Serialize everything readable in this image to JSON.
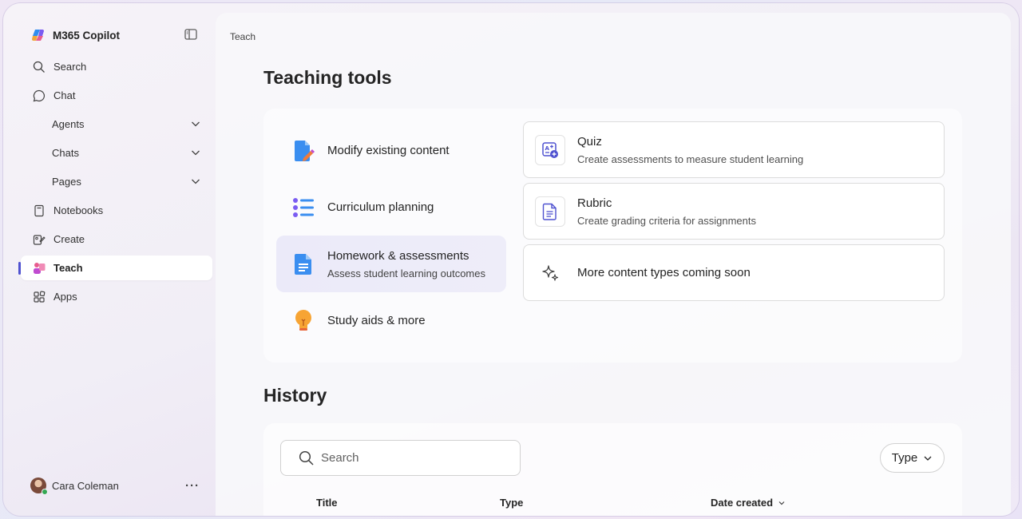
{
  "app": {
    "name": "M365 Copilot"
  },
  "sidebar": {
    "items": [
      {
        "label": "Search",
        "icon": "search-icon"
      },
      {
        "label": "Chat",
        "icon": "chat-icon"
      },
      {
        "label": "Agents",
        "expandable": true
      },
      {
        "label": "Chats",
        "expandable": true
      },
      {
        "label": "Pages",
        "expandable": true
      },
      {
        "label": "Notebooks",
        "icon": "notebook-icon"
      },
      {
        "label": "Create",
        "icon": "create-icon"
      },
      {
        "label": "Teach",
        "icon": "teach-icon",
        "active": true
      },
      {
        "label": "Apps",
        "icon": "apps-icon"
      }
    ],
    "user": {
      "name": "Cara Coleman",
      "more": "···"
    }
  },
  "main": {
    "breadcrumb": "Teach",
    "title": "Teaching tools",
    "categories": [
      {
        "title": "Modify existing content",
        "subtitle": "",
        "icon": "pencil-doc-icon"
      },
      {
        "title": "Curriculum planning",
        "subtitle": "",
        "icon": "list-icon"
      },
      {
        "title": "Homework & assessments",
        "subtitle": "Assess student learning outcomes",
        "icon": "document-icon",
        "selected": true
      },
      {
        "title": "Study aids & more",
        "subtitle": "",
        "icon": "lightbulb-icon"
      }
    ],
    "tools": [
      {
        "title": "Quiz",
        "subtitle": "Create assessments to measure student learning",
        "icon": "quiz-icon"
      },
      {
        "title": "Rubric",
        "subtitle": "Create grading criteria for assignments",
        "icon": "rubric-icon"
      },
      {
        "title": "More content types coming soon",
        "subtitle": "",
        "icon": "sparkle-icon"
      }
    ],
    "history": {
      "title": "History",
      "search_placeholder": "Search",
      "type_filter": "Type",
      "columns": [
        "Title",
        "Type",
        "Date created"
      ]
    }
  },
  "colors": {
    "accent": "#4f52d0",
    "selected_bg": "#ecebf9"
  }
}
